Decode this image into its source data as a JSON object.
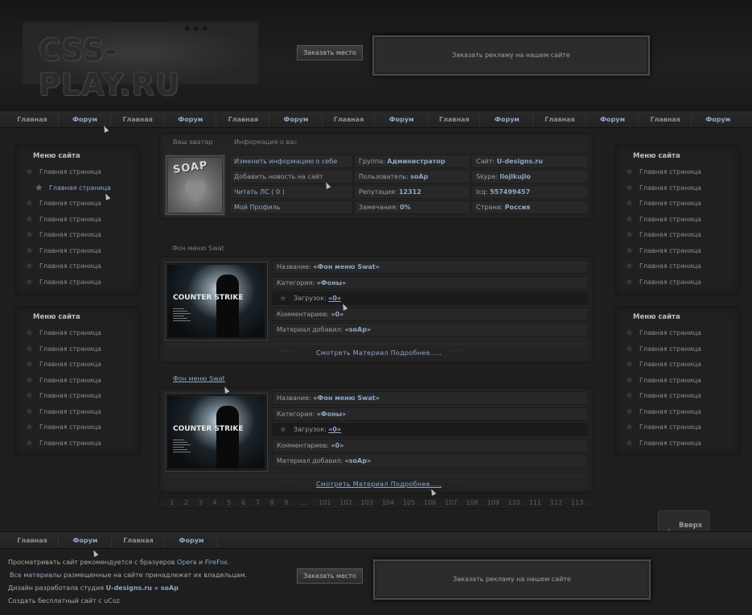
{
  "header": {
    "logo_text": "CSS-PLAY.RU",
    "logo_stars": "★★★",
    "order_label": "Заказать место",
    "ad_text": "Заказать рекламу  на нашем сайте"
  },
  "nav": {
    "items": [
      "Главная",
      "Форум",
      "Главная",
      "Форум",
      "Главная",
      "Форум",
      "Главная",
      "Форум",
      "Главная",
      "Форум",
      "Главная",
      "Форум",
      "Главная",
      "Форум"
    ]
  },
  "sidebar": {
    "title": "Меню сайта",
    "item_label": "Главная страница"
  },
  "profile": {
    "tab_avatar": "Ваш аватар",
    "tab_info": "Информация о вас",
    "avatar_text": "SOAP",
    "col1": [
      "Изменить информацию о себе",
      "Добавить новость на сайт",
      "Читать ЛС ( 0 )",
      "Мой Профиль"
    ],
    "col2": [
      {
        "label": "Группа: ",
        "value": "Администратор"
      },
      {
        "label": "Пользователь: ",
        "value": "soAp"
      },
      {
        "label": "Репутация: ",
        "value": "12312"
      },
      {
        "label": "Замечания: ",
        "value": "0%"
      }
    ],
    "col3": [
      {
        "label": "Сайт: ",
        "value": "U-designs.ru"
      },
      {
        "label": "Skype: ",
        "value": "llojlkujlo"
      },
      {
        "label": "Icq: ",
        "value": "557499457"
      },
      {
        "label": "Страна: ",
        "value": "Россия"
      }
    ]
  },
  "materials": [
    {
      "title": "Фон меню Swat",
      "thumb_title": "COUNTER STRIKE",
      "rows": [
        {
          "label": "Название: ",
          "value": "«Фон меню Swat»"
        },
        {
          "label": "Категория: ",
          "value": "«Фоны»"
        },
        {
          "label": "Загрузок: ",
          "value": "«0»"
        },
        {
          "label": "Комментариев: ",
          "value": "«0»"
        },
        {
          "label": "Материал добавил: ",
          "value": "«soAp»"
        }
      ],
      "more": "Смотреть Материал Подробнее....."
    },
    {
      "title": "Фон меню Swat",
      "thumb_title": "COUNTER STRIKE",
      "rows": [
        {
          "label": "Название: ",
          "value": "«Фон меню Swat»"
        },
        {
          "label": "Категория: ",
          "value": "«Фоны»"
        },
        {
          "label": "Загрузок: ",
          "value": "«0»"
        },
        {
          "label": "Комментариев: ",
          "value": "«0»"
        },
        {
          "label": "Материал добавил: ",
          "value": "«soAp»"
        }
      ],
      "more": "Смотреть Материал Подробнее....."
    }
  ],
  "pagination": [
    "1",
    "2",
    "3",
    "4",
    "5",
    "6",
    "7",
    "8",
    "9",
    "....",
    "101",
    "102",
    "103",
    "104",
    "105",
    "106",
    "107",
    "108",
    "109",
    "110",
    "111",
    "112",
    "113"
  ],
  "up_button": "Вверх",
  "footer": {
    "nav": [
      "Главная",
      "Форум",
      "Главная",
      "Форум"
    ],
    "line1_pre": "Просматривать сайт рекомендуется с бразуеров ",
    "line1_link1": "Opera",
    "line1_mid": " и ",
    "line1_link2": "FireFox",
    "line1_post": ".",
    "line2_link": "Все материалы",
    "line2_post": " размещенные на сайте принадлежат их владельцам.",
    "line3_pre": "Дизайн разработала студия ",
    "line3_bold": "U-designs.ru » soAp",
    "line4_pre": "Создать бесплатный сайт с ",
    "line4_link": "uCoz",
    "order_label": "Заказать место",
    "ad_text": "Заказать рекламу  на нашем сайте"
  },
  "colors": {
    "background": "#1e1e1e",
    "accent": "#8fa6c8",
    "text": "#a8a8a8"
  }
}
